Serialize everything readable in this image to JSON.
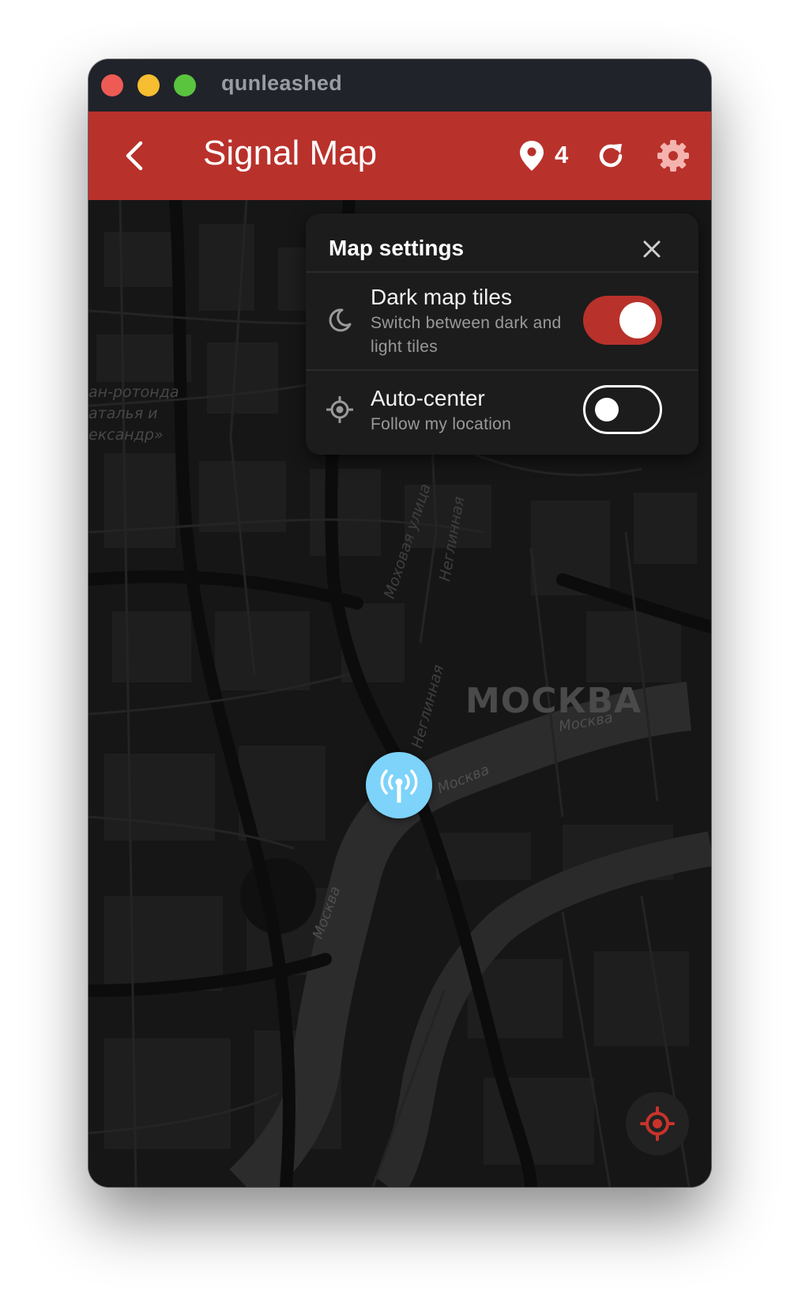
{
  "window": {
    "title": "qunleashed"
  },
  "appbar": {
    "back_icon": "chevron-left-icon",
    "title": "Signal Map",
    "pin_icon": "map-pin-icon",
    "pin_count": "4",
    "refresh_icon": "refresh-icon",
    "settings_icon": "gear-icon",
    "color": "#b9312b"
  },
  "map": {
    "city_label": "МОСКВА",
    "river_labels": [
      "Москва",
      "Москва",
      "Москва"
    ],
    "street_labels": [
      "Моховая улица",
      "Неглинная",
      "Неглинная"
    ],
    "poi_label_lines": [
      "ан-ротонда",
      "аталья и",
      "ександр»"
    ],
    "marker_icon": "cell-tower-icon",
    "marker_color": "#7dd3fa",
    "locate_icon": "crosshair-icon"
  },
  "settings_panel": {
    "title": "Map settings",
    "close_icon": "close-icon",
    "rows": [
      {
        "icon": "moon-icon",
        "title": "Dark map tiles",
        "subtitle": "Switch between dark and light tiles",
        "enabled": true
      },
      {
        "icon": "location-target-icon",
        "title": "Auto-center",
        "subtitle": "Follow my location",
        "enabled": false
      }
    ]
  }
}
